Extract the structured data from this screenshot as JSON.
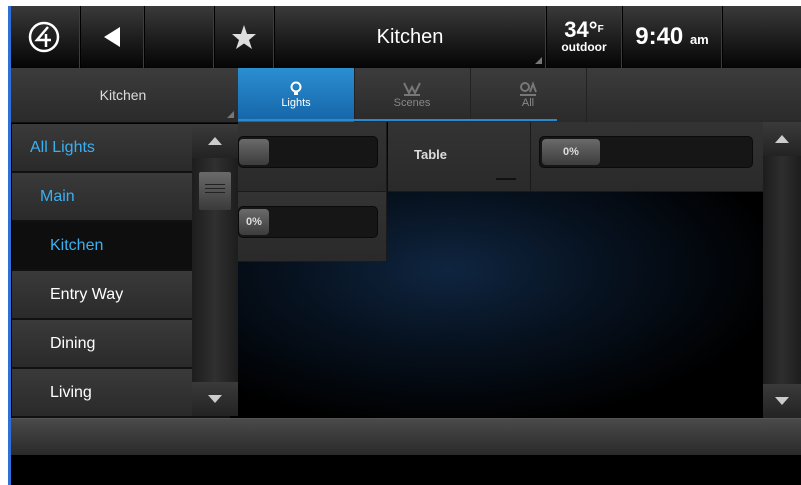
{
  "header": {
    "room_title": "Kitchen",
    "temp_value": "34°",
    "temp_unit": "F",
    "temp_label": "outdoor",
    "time": "9:40",
    "ampm": "am"
  },
  "subbar": {
    "room_label": "Kitchen",
    "tabs": [
      {
        "label": "Lights",
        "icon": "bulb-icon",
        "active": true
      },
      {
        "label": "Scenes",
        "icon": "scenes-icon",
        "active": false
      },
      {
        "label": "All",
        "icon": "all-icon",
        "active": false
      }
    ]
  },
  "nav": {
    "items": [
      {
        "label": "All Lights",
        "color": "#3ab0f0"
      },
      {
        "label": "Main",
        "color": "#3ab0f0"
      },
      {
        "label": "Kitchen",
        "color": "#3ab0f0"
      },
      {
        "label": "Entry Way",
        "color": "#ffffff"
      },
      {
        "label": "Dining",
        "color": "#ffffff"
      },
      {
        "label": "Living",
        "color": "#ffffff"
      }
    ]
  },
  "lights": [
    {
      "name": "",
      "level_label": ""
    },
    {
      "name": "Table",
      "level_label": "0%"
    },
    {
      "name": "",
      "level_label": "0%"
    }
  ],
  "colors": {
    "accent": "#2a8ad0",
    "active_tab": "#1a78c0"
  }
}
